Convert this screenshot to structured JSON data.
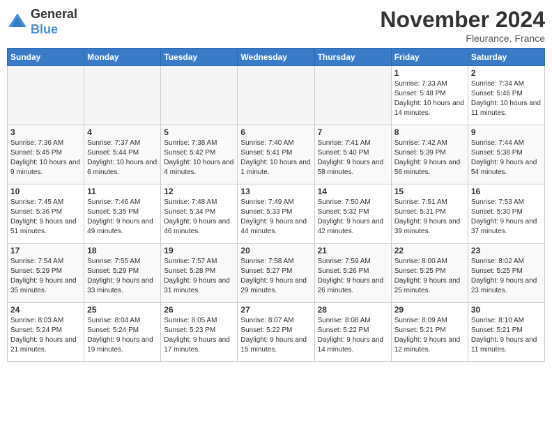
{
  "logo": {
    "general": "General",
    "blue": "Blue"
  },
  "title": "November 2024",
  "location": "Fleurance, France",
  "weekdays": [
    "Sunday",
    "Monday",
    "Tuesday",
    "Wednesday",
    "Thursday",
    "Friday",
    "Saturday"
  ],
  "weeks": [
    [
      {
        "day": "",
        "info": ""
      },
      {
        "day": "",
        "info": ""
      },
      {
        "day": "",
        "info": ""
      },
      {
        "day": "",
        "info": ""
      },
      {
        "day": "",
        "info": ""
      },
      {
        "day": "1",
        "info": "Sunrise: 7:33 AM\nSunset: 5:48 PM\nDaylight: 10 hours and 14 minutes."
      },
      {
        "day": "2",
        "info": "Sunrise: 7:34 AM\nSunset: 5:46 PM\nDaylight: 10 hours and 11 minutes."
      }
    ],
    [
      {
        "day": "3",
        "info": "Sunrise: 7:36 AM\nSunset: 5:45 PM\nDaylight: 10 hours and 9 minutes."
      },
      {
        "day": "4",
        "info": "Sunrise: 7:37 AM\nSunset: 5:44 PM\nDaylight: 10 hours and 6 minutes."
      },
      {
        "day": "5",
        "info": "Sunrise: 7:38 AM\nSunset: 5:42 PM\nDaylight: 10 hours and 4 minutes."
      },
      {
        "day": "6",
        "info": "Sunrise: 7:40 AM\nSunset: 5:41 PM\nDaylight: 10 hours and 1 minute."
      },
      {
        "day": "7",
        "info": "Sunrise: 7:41 AM\nSunset: 5:40 PM\nDaylight: 9 hours and 58 minutes."
      },
      {
        "day": "8",
        "info": "Sunrise: 7:42 AM\nSunset: 5:39 PM\nDaylight: 9 hours and 56 minutes."
      },
      {
        "day": "9",
        "info": "Sunrise: 7:44 AM\nSunset: 5:38 PM\nDaylight: 9 hours and 54 minutes."
      }
    ],
    [
      {
        "day": "10",
        "info": "Sunrise: 7:45 AM\nSunset: 5:36 PM\nDaylight: 9 hours and 51 minutes."
      },
      {
        "day": "11",
        "info": "Sunrise: 7:46 AM\nSunset: 5:35 PM\nDaylight: 9 hours and 49 minutes."
      },
      {
        "day": "12",
        "info": "Sunrise: 7:48 AM\nSunset: 5:34 PM\nDaylight: 9 hours and 46 minutes."
      },
      {
        "day": "13",
        "info": "Sunrise: 7:49 AM\nSunset: 5:33 PM\nDaylight: 9 hours and 44 minutes."
      },
      {
        "day": "14",
        "info": "Sunrise: 7:50 AM\nSunset: 5:32 PM\nDaylight: 9 hours and 42 minutes."
      },
      {
        "day": "15",
        "info": "Sunrise: 7:51 AM\nSunset: 5:31 PM\nDaylight: 9 hours and 39 minutes."
      },
      {
        "day": "16",
        "info": "Sunrise: 7:53 AM\nSunset: 5:30 PM\nDaylight: 9 hours and 37 minutes."
      }
    ],
    [
      {
        "day": "17",
        "info": "Sunrise: 7:54 AM\nSunset: 5:29 PM\nDaylight: 9 hours and 35 minutes."
      },
      {
        "day": "18",
        "info": "Sunrise: 7:55 AM\nSunset: 5:29 PM\nDaylight: 9 hours and 33 minutes."
      },
      {
        "day": "19",
        "info": "Sunrise: 7:57 AM\nSunset: 5:28 PM\nDaylight: 9 hours and 31 minutes."
      },
      {
        "day": "20",
        "info": "Sunrise: 7:58 AM\nSunset: 5:27 PM\nDaylight: 9 hours and 29 minutes."
      },
      {
        "day": "21",
        "info": "Sunrise: 7:59 AM\nSunset: 5:26 PM\nDaylight: 9 hours and 26 minutes."
      },
      {
        "day": "22",
        "info": "Sunrise: 8:00 AM\nSunset: 5:25 PM\nDaylight: 9 hours and 25 minutes."
      },
      {
        "day": "23",
        "info": "Sunrise: 8:02 AM\nSunset: 5:25 PM\nDaylight: 9 hours and 23 minutes."
      }
    ],
    [
      {
        "day": "24",
        "info": "Sunrise: 8:03 AM\nSunset: 5:24 PM\nDaylight: 9 hours and 21 minutes."
      },
      {
        "day": "25",
        "info": "Sunrise: 8:04 AM\nSunset: 5:24 PM\nDaylight: 9 hours and 19 minutes."
      },
      {
        "day": "26",
        "info": "Sunrise: 8:05 AM\nSunset: 5:23 PM\nDaylight: 9 hours and 17 minutes."
      },
      {
        "day": "27",
        "info": "Sunrise: 8:07 AM\nSunset: 5:22 PM\nDaylight: 9 hours and 15 minutes."
      },
      {
        "day": "28",
        "info": "Sunrise: 8:08 AM\nSunset: 5:22 PM\nDaylight: 9 hours and 14 minutes."
      },
      {
        "day": "29",
        "info": "Sunrise: 8:09 AM\nSunset: 5:21 PM\nDaylight: 9 hours and 12 minutes."
      },
      {
        "day": "30",
        "info": "Sunrise: 8:10 AM\nSunset: 5:21 PM\nDaylight: 9 hours and 11 minutes."
      }
    ]
  ]
}
